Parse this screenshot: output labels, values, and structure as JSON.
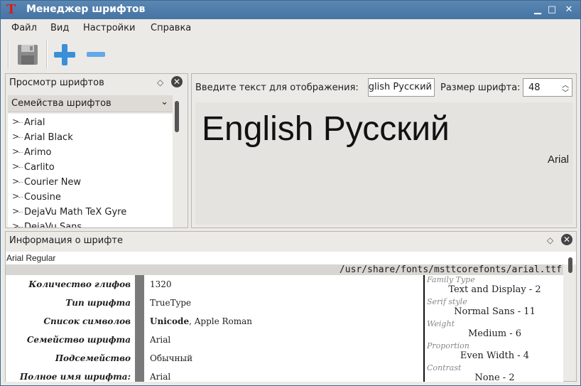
{
  "window": {
    "title": "Менеджер шрифтов",
    "app_icon": "T",
    "controls": {
      "minimize": "▁",
      "maximize": "□",
      "close": "✕"
    }
  },
  "menubar": [
    "Файл",
    "Вид",
    "Настройки",
    "Справка"
  ],
  "toolbar": {
    "buttons": [
      {
        "name": "save-icon",
        "enabled": false
      },
      {
        "name": "plus-icon",
        "enabled": true
      },
      {
        "name": "minus-icon",
        "enabled": true
      }
    ]
  },
  "font_browser": {
    "title": "Просмотр шрифтов",
    "float_icon": "◇",
    "close_icon": "✕",
    "filter_value": "Семейства шрифтов",
    "families": [
      "Arial",
      "Arial Black",
      "Arimo",
      "Carlito",
      "Courier New",
      "Cousine",
      "DejaVu Math TeX Gyre",
      "DejaVu Sans"
    ]
  },
  "preview": {
    "prompt_label": "Введите текст для отображения:",
    "input_value": "English Русский",
    "size_label": "Размер шрифта:",
    "size_value": "48",
    "sample_text": "English Русский",
    "sample_font_name": "Arial"
  },
  "font_info": {
    "title": "Информация о шрифте",
    "float_icon": "◇",
    "close_icon": "✕",
    "font_name": "Arial Regular",
    "path": "/usr/share/fonts/msttcorefonts/arial.ttf",
    "rows": [
      {
        "key": "Количество глифов",
        "value": "1320"
      },
      {
        "key": "Тип шрифта",
        "value": "TrueType"
      },
      {
        "key": "Список символов",
        "value_bold": "Unicode",
        "value": ", Apple Roman"
      },
      {
        "key": "Семейство шрифта",
        "value": "Arial"
      },
      {
        "key": "Подсемейство",
        "value": "Обычный"
      },
      {
        "key": "Полное имя шрифта:",
        "value": "Arial"
      }
    ],
    "panose": [
      {
        "key": "Family Type",
        "value": "Text and Display - 2"
      },
      {
        "key": "Serif style",
        "value": "Normal Sans - 11"
      },
      {
        "key": "Weight",
        "value": "Medium - 6"
      },
      {
        "key": "Proportion",
        "value": "Even Width - 4"
      },
      {
        "key": "Contrast",
        "value": "None - 2"
      }
    ]
  },
  "colors": {
    "titlebar": "#4574a3",
    "accent_blue": "#3b8fd9",
    "disabled": "#8a8a8a"
  }
}
